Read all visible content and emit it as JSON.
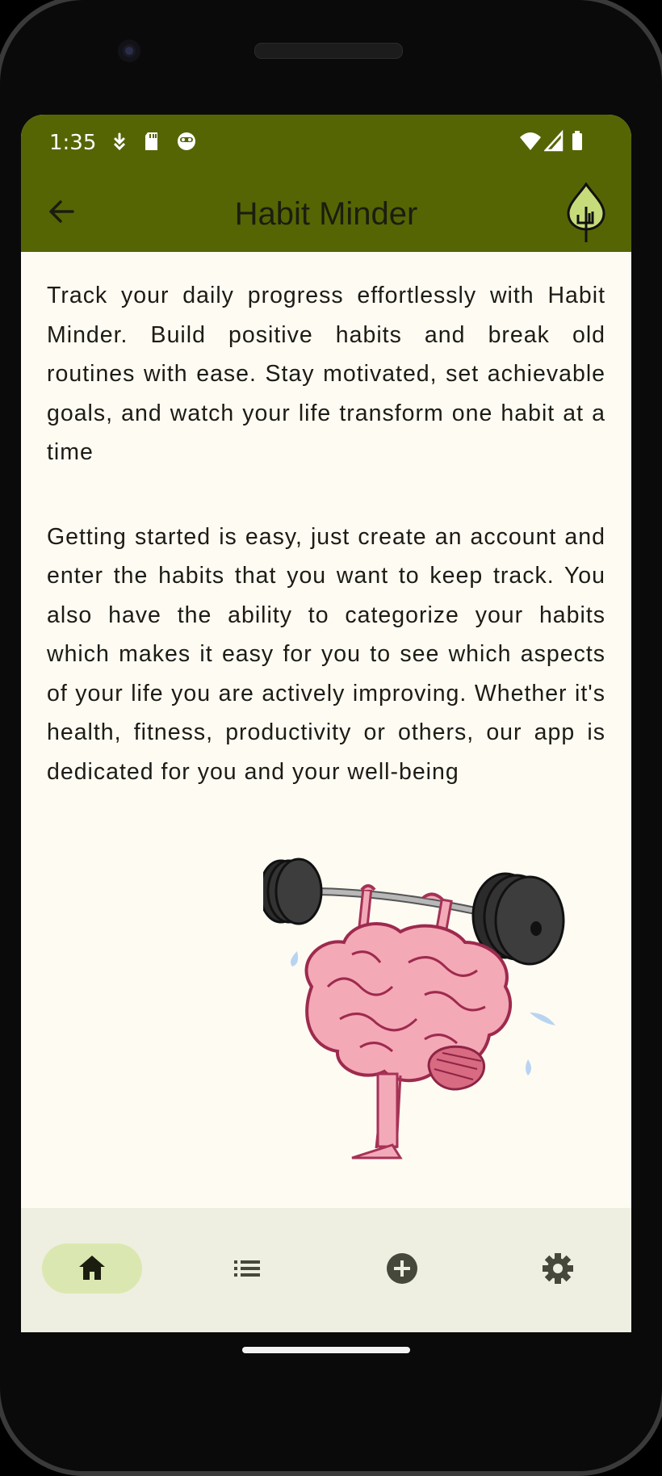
{
  "status_bar": {
    "time": "1:35",
    "icons": [
      "download-icon",
      "sd-card-icon",
      "face-icon",
      "wifi-icon",
      "signal-icon",
      "battery-icon"
    ]
  },
  "app_bar": {
    "title": "Habit Minder",
    "back_icon": "arrow-back-icon",
    "logo_icon": "leaf-logo-icon"
  },
  "content": {
    "paragraph_1": "Track your daily progress effortlessly with Habit Minder. Build positive habits and break old routines with ease. Stay motivated, set achievable goals, and watch your life transform one habit at a time",
    "paragraph_2": "Getting started is easy, just create an account and enter the habits that you want to keep track. You also have the ability to categorize your habits which makes it easy for you to see which aspects of your life you are actively improving. Whether it's health, fitness, productivity or others, our app is dedicated for you and your well-being",
    "illustration": "brain-lifting-barbell-illustration"
  },
  "bottom_nav": {
    "items": [
      {
        "icon": "home-icon",
        "active": true
      },
      {
        "icon": "list-icon",
        "active": false
      },
      {
        "icon": "add-circle-icon",
        "active": false
      },
      {
        "icon": "settings-gear-icon",
        "active": false
      }
    ]
  },
  "colors": {
    "app_bar": "#566503",
    "background": "#fefbf3",
    "nav_bar": "#eeefe0",
    "nav_active_pill": "#dbe7b0",
    "text": "#1c1c14"
  }
}
